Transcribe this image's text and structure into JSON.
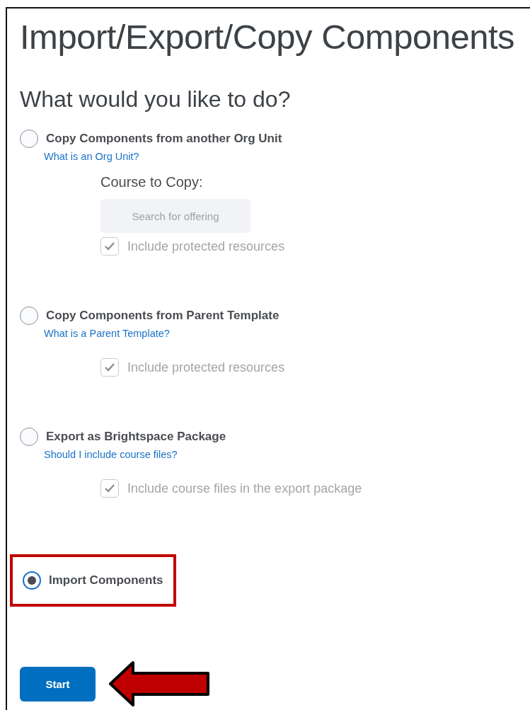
{
  "title": "Import/Export/Copy Components",
  "question": "What would you like to do?",
  "options": [
    {
      "label": "Copy Components from another Org Unit",
      "help_link": "What is an Org Unit?",
      "selected": false,
      "highlighted": false,
      "course_label": "Course to Copy:",
      "search": {
        "placeholder": "Search for offering"
      },
      "checkbox": {
        "label": "Include protected resources",
        "checked": true,
        "disabled": true
      }
    },
    {
      "label": "Copy Components from Parent Template",
      "help_link": "What is a Parent Template?",
      "selected": false,
      "highlighted": false,
      "checkbox": {
        "label": "Include protected resources",
        "checked": true,
        "disabled": true
      }
    },
    {
      "label": "Export as Brightspace Package",
      "help_link": "Should I include course files?",
      "selected": false,
      "highlighted": false,
      "checkbox": {
        "label": "Include course files in the export package",
        "checked": true,
        "disabled": true
      }
    },
    {
      "label": "Import Components",
      "selected": true,
      "highlighted": true
    }
  ],
  "start_button": "Start"
}
